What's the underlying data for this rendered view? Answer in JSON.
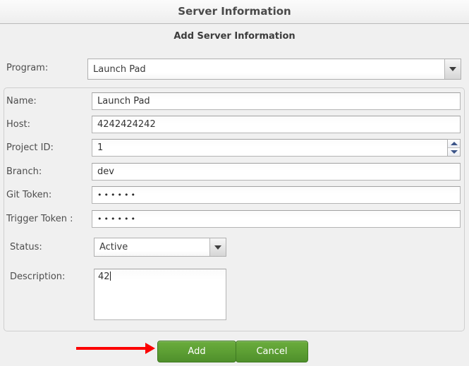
{
  "window": {
    "title": "Server Information"
  },
  "form": {
    "subtitle": "Add Server Information",
    "program": {
      "label": "Program:",
      "value": "Launch Pad",
      "icon": "chevron-down-icon"
    },
    "fields": [
      {
        "label": "Name:",
        "value": "Launch Pad",
        "type": "text"
      },
      {
        "label": "Host:",
        "value": "4242424242",
        "type": "text"
      },
      {
        "label": "Project ID:",
        "value": "1",
        "type": "spinner"
      },
      {
        "label": "Branch:",
        "value": "dev",
        "type": "text"
      },
      {
        "label": "Git Token:",
        "value": "••••••",
        "type": "password"
      },
      {
        "label": "Trigger Token :",
        "value": "••••••",
        "type": "password"
      }
    ],
    "status": {
      "label": "Status:",
      "value": "Active",
      "icon": "chevron-down-icon"
    },
    "description": {
      "label": "Description:",
      "value": "42"
    }
  },
  "buttons": {
    "add": "Add",
    "cancel": "Cancel"
  },
  "annotation": {
    "type": "arrow-pointing-right",
    "color": "#fc0000",
    "points_to": "Add"
  },
  "colors": {
    "button_green": "#5d9f34",
    "annotation_red": "#fc0000",
    "spinner_arrow_blue": "#3b5488",
    "window_background": "#f0f0f0"
  }
}
